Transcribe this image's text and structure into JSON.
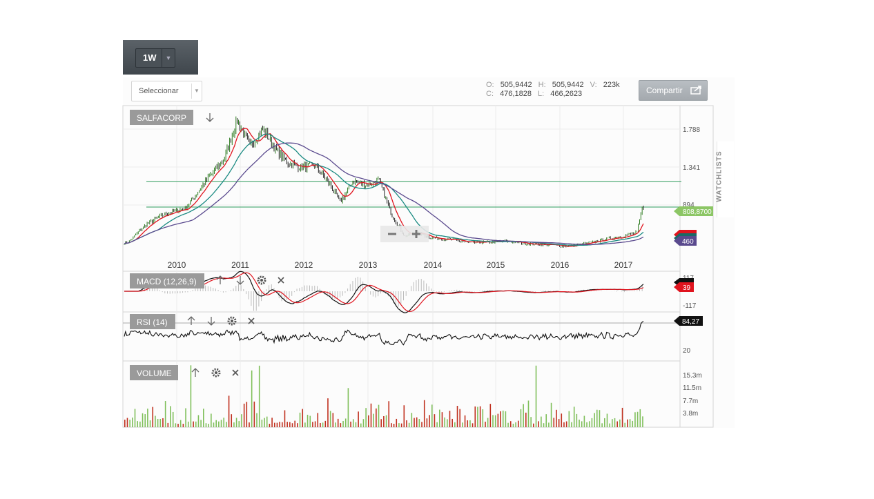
{
  "toolbar": {
    "timeframe": "1W",
    "select_label": "Seleccionar",
    "share_label": "Compartir"
  },
  "ohlc": {
    "o_label": "O:",
    "o": "505,9442",
    "h_label": "H:",
    "h": "505,9442",
    "v_label": "V:",
    "v": "223k",
    "c_label": "C:",
    "c": "476,1828",
    "l_label": "L:",
    "l": "466,2623"
  },
  "sidebar": {
    "watchlists": "WATCHLISTS"
  },
  "colors": {
    "up": "#5aa83a",
    "down": "#c7291b",
    "ema_fast": "#e0141e",
    "ema_mid": "#1a8a82",
    "ema_slow": "#5a4a8e",
    "hline": "#2a9a5a",
    "last_price": "#8cc665",
    "macd_line": "#111111",
    "signal_line": "#e0141e"
  },
  "chart_data": [
    {
      "type": "candlestick",
      "title": "SALFACORP",
      "x_ticks": [
        "2010",
        "2011",
        "2012",
        "2013",
        "2014",
        "2015",
        "2016",
        "2017"
      ],
      "y_ticks": [
        "1.788",
        "1.341",
        "894"
      ],
      "horizontal_lines": [
        1190,
        894
      ],
      "last_price_label": "808,8700",
      "indicator_badge": "460",
      "series": [
        {
          "name": "price",
          "x": [
            2009.3,
            2009.6,
            2009.9,
            2010.2,
            2010.5,
            2010.8,
            2011.0,
            2011.2,
            2011.4,
            2011.6,
            2011.8,
            2012.0,
            2012.2,
            2012.4,
            2012.6,
            2012.8,
            2013.0,
            2013.2,
            2013.4,
            2013.6,
            2013.8,
            2014.0,
            2014.3,
            2014.6,
            2014.9,
            2015.2,
            2015.5,
            2015.8,
            2016.1,
            2016.4,
            2016.7,
            2017.0,
            2017.2,
            2017.28
          ],
          "values": [
            480,
            700,
            820,
            880,
            1180,
            1450,
            1900,
            1600,
            1800,
            1550,
            1400,
            1350,
            1380,
            1200,
            950,
            1200,
            1150,
            1200,
            800,
            560,
            600,
            540,
            520,
            480,
            490,
            500,
            470,
            460,
            440,
            470,
            520,
            560,
            600,
            880
          ]
        }
      ]
    },
    {
      "type": "line",
      "title": "MACD (12,26,9)",
      "y_ticks": [
        "117",
        "-117"
      ],
      "last_value_label": "39"
    },
    {
      "type": "line",
      "title": "RSI (14)",
      "y_ticks": [
        "20"
      ],
      "last_value_label": "84,27"
    },
    {
      "type": "bar",
      "title": "VOLUME",
      "y_ticks": [
        "15.3m",
        "11.5m",
        "7.7m",
        "3.8m"
      ]
    }
  ]
}
